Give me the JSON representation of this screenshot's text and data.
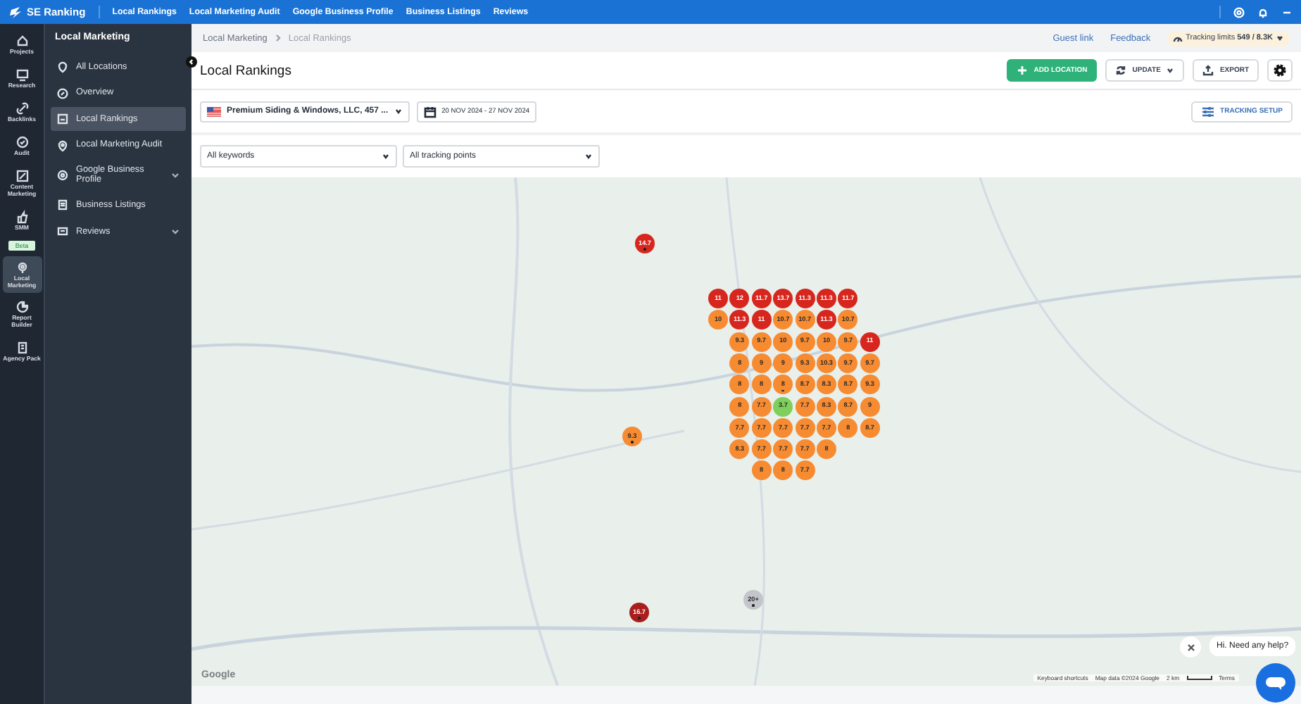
{
  "topbar": {
    "logo": "SE Ranking",
    "nav": [
      "Local Rankings",
      "Local Marketing Audit",
      "Google Business Profile",
      "Business Listings",
      "Reviews"
    ]
  },
  "rail": [
    {
      "label": "Projects",
      "selected": false
    },
    {
      "label": "Research",
      "selected": false
    },
    {
      "label": "Backlinks",
      "selected": false
    },
    {
      "label": "Audit",
      "selected": false
    },
    {
      "label": "Content Marketing",
      "selected": false
    },
    {
      "label": "SMM",
      "selected": false,
      "badge": "Beta"
    },
    {
      "label": "Local Marketing",
      "selected": true
    },
    {
      "label": "Report Builder",
      "selected": false
    },
    {
      "label": "Agency Pack",
      "selected": false
    }
  ],
  "sidebar": {
    "title": "Local Marketing",
    "items": [
      {
        "label": "All Locations",
        "kind": "link",
        "selected": false
      },
      {
        "label": "Overview",
        "kind": "link",
        "selected": false
      },
      {
        "label": "Local Rankings",
        "kind": "link",
        "selected": true
      },
      {
        "label": "Local Marketing Audit",
        "kind": "link",
        "selected": false
      },
      {
        "label": "Google Business Profile",
        "kind": "group",
        "selected": false,
        "expanded": false
      },
      {
        "label": "Business Listings",
        "kind": "link",
        "selected": false
      },
      {
        "label": "Reviews",
        "kind": "group",
        "selected": false,
        "expanded": false
      }
    ]
  },
  "breadcrumb": [
    "Local Marketing",
    "Local Rankings"
  ],
  "header_links": [
    "Guest link",
    "Feedback"
  ],
  "tracking_limits": {
    "label": "Tracking limits",
    "value": "549 / 8.3K"
  },
  "page_title": "Local Rankings",
  "actions": [
    "ADD LOCATION",
    "UPDATE",
    "EXPORT"
  ],
  "location_select": "Premium Siding & Windows, LLC, 457 ...",
  "date_range": "20 NOV 2024 - 27 NOV 2024",
  "tracking_setup": "TRACKING SETUP",
  "filters": [
    "All keywords",
    "All tracking points"
  ],
  "map": {
    "grid": [
      {
        "kind": "wide",
        "cells": [
          {
            "value": "11",
            "color": "#d7261e",
            "dot": false
          },
          {
            "value": "12",
            "color": "#d7261e",
            "dot": false
          },
          {
            "value": "11.7",
            "color": "#d7261e",
            "dot": false
          },
          {
            "value": "13.7",
            "color": "#d7261e",
            "dot": false
          },
          {
            "value": "11.3",
            "color": "#d7261e",
            "dot": false
          },
          {
            "value": "11.3",
            "color": "#d7261e",
            "dot": false
          },
          {
            "value": "11.7",
            "color": "#d7261e",
            "dot": false
          }
        ]
      },
      {
        "kind": "wide",
        "cells": [
          {
            "value": "10",
            "color": "#f68b32",
            "dot": false
          },
          {
            "value": "11.3",
            "color": "#d7261e",
            "dot": false
          },
          {
            "value": "11",
            "color": "#d7261e",
            "dot": false
          },
          {
            "value": "10.7",
            "color": "#f68b32",
            "dot": false
          },
          {
            "value": "10.7",
            "color": "#f68b32",
            "dot": false
          },
          {
            "value": "11.3",
            "color": "#d7261e",
            "dot": false
          },
          {
            "value": "10.7",
            "color": "#f68b32",
            "dot": false
          }
        ]
      },
      {
        "kind": "inset",
        "cells": [
          {
            "value": "9.3",
            "color": "#f68b32",
            "dot": false
          },
          {
            "value": "9.7",
            "color": "#f68b32",
            "dot": false
          },
          {
            "value": "10",
            "color": "#f68b32",
            "dot": false
          },
          {
            "value": "9.7",
            "color": "#f68b32",
            "dot": false
          },
          {
            "value": "10",
            "color": "#f68b32",
            "dot": false
          },
          {
            "value": "9.7",
            "color": "#f68b32",
            "dot": false
          },
          {
            "value": "11",
            "color": "#d7261e",
            "dot": false
          }
        ]
      },
      {
        "kind": "inset",
        "cells": [
          {
            "value": "8",
            "color": "#f68b32",
            "dot": false
          },
          {
            "value": "9",
            "color": "#f68b32",
            "dot": false
          },
          {
            "value": "9",
            "color": "#f68b32",
            "dot": false
          },
          {
            "value": "9.3",
            "color": "#f68b32",
            "dot": false
          },
          {
            "value": "10.3",
            "color": "#f68b32",
            "dot": false
          },
          {
            "value": "9.7",
            "color": "#f68b32",
            "dot": false
          },
          {
            "value": "9.7",
            "color": "#f68b32",
            "dot": false
          }
        ]
      },
      {
        "kind": "inset",
        "cells": [
          {
            "value": "8",
            "color": "#f68b32",
            "dot": false
          },
          {
            "value": "8",
            "color": "#f68b32",
            "dot": false
          },
          {
            "value": "8",
            "color": "#f68b32",
            "dot": true
          },
          {
            "value": "8.7",
            "color": "#f68b32",
            "dot": false
          },
          {
            "value": "8.3",
            "color": "#f68b32",
            "dot": false
          },
          {
            "value": "8.7",
            "color": "#f68b32",
            "dot": false
          },
          {
            "value": "9.3",
            "color": "#f68b32",
            "dot": false
          }
        ]
      },
      {
        "kind": "inset",
        "cells": [
          {
            "value": "8",
            "color": "#f68b32",
            "dot": false
          },
          {
            "value": "7.7",
            "color": "#f68b32",
            "dot": false
          },
          {
            "value": "3.7",
            "color": "#7fcf5c",
            "dot": false
          },
          {
            "value": "7.7",
            "color": "#f68b32",
            "dot": false
          },
          {
            "value": "8.3",
            "color": "#f68b32",
            "dot": false
          },
          {
            "value": "8.7",
            "color": "#f68b32",
            "dot": false
          },
          {
            "value": "9",
            "color": "#f68b32",
            "dot": false
          }
        ]
      },
      {
        "kind": "inset",
        "cells": [
          {
            "value": "7.7",
            "color": "#f68b32",
            "dot": false
          },
          {
            "value": "7.7",
            "color": "#f68b32",
            "dot": false
          },
          {
            "value": "7.7",
            "color": "#f68b32",
            "dot": false
          },
          {
            "value": "7.7",
            "color": "#f68b32",
            "dot": false
          },
          {
            "value": "7.7",
            "color": "#f68b32",
            "dot": false
          },
          {
            "value": "8",
            "color": "#f68b32",
            "dot": false
          },
          {
            "value": "8.7",
            "color": "#f68b32",
            "dot": false
          }
        ]
      },
      {
        "kind": "inset",
        "cells": [
          {
            "value": "8.3",
            "color": "#f68b32",
            "dot": false
          },
          {
            "value": "7.7",
            "color": "#f68b32",
            "dot": false
          },
          {
            "value": "7.7",
            "color": "#f68b32",
            "dot": false
          },
          {
            "value": "7.7",
            "color": "#f68b32",
            "dot": false
          },
          {
            "value": "8",
            "color": "#f68b32",
            "dot": false
          }
        ]
      },
      {
        "kind": "narrow",
        "cells": [
          {
            "value": "8",
            "color": "#f68b32",
            "dot": false
          },
          {
            "value": "8",
            "color": "#f68b32",
            "dot": false
          },
          {
            "value": "7.7",
            "color": "#f68b32",
            "dot": false
          }
        ]
      }
    ],
    "competitors": [
      {
        "value": "14.7",
        "color": "#d7261e",
        "dot": true
      },
      {
        "value": "9.3",
        "color": "#f68b32",
        "dot": true
      },
      {
        "value": "16.7",
        "color": "#a91d1d",
        "dot": true
      },
      {
        "value": "20+",
        "color": "#c2c6cc",
        "dot": true
      }
    ],
    "attribution": [
      "Google",
      "Keyboard shortcuts",
      "Map data ©2024 Google",
      "2 km",
      "Terms"
    ]
  },
  "chat": {
    "message": "Hi. Need any help?"
  }
}
